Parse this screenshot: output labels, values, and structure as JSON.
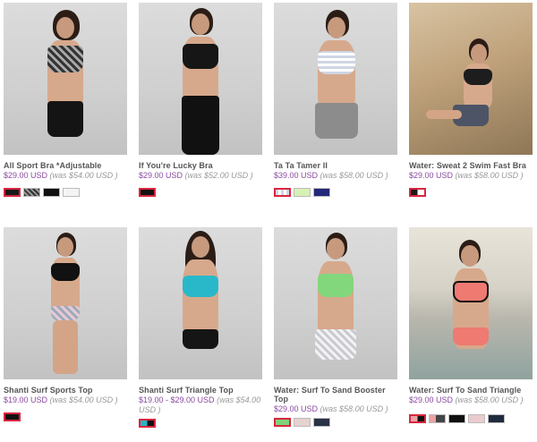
{
  "products": [
    {
      "name": "All Sport Bra *Adjustable",
      "price": "$29.00 USD",
      "was": "(was $54.00 USD )",
      "swatches": [
        "#1a1a1a",
        "#6e6e6e",
        "#111111",
        "#f4f4f4"
      ]
    },
    {
      "name": "If You're Lucky Bra",
      "price": "$29.00 USD",
      "was": "(was $52.00 USD )",
      "swatches": [
        "#111111"
      ]
    },
    {
      "name": "Ta Ta Tamer II",
      "price": "$39.00 USD",
      "was": "(was $58.00 USD )",
      "swatches": [
        "#dfe3ee",
        "#d9f0b5",
        "#23287a"
      ]
    },
    {
      "name": "Water: Sweat 2 Swim Fast Bra",
      "price": "$29.00 USD",
      "was": "(was $58.00 USD )",
      "swatches": [
        "#1a1a1a"
      ]
    },
    {
      "name": "Shanti Surf Sports Top",
      "price": "$19.00 USD",
      "was": "(was $54.00 USD )",
      "swatches": [
        "#111111"
      ]
    },
    {
      "name": "Shanti Surf Triangle Top",
      "price": "$19.00 - $29.00 USD",
      "was": "(was $54.00 USD )",
      "swatches": [
        "#2ab3c4"
      ]
    },
    {
      "name": "Water: Surf To Sand Booster Top",
      "price": "$29.00 USD",
      "was": "(was $58.00 USD )",
      "swatches": [
        "#7fd27a",
        "#e6d2cf",
        "#2a3246"
      ]
    },
    {
      "name": "Water: Surf To Sand Triangle",
      "price": "$29.00 USD",
      "was": "(was $58.00 USD )",
      "swatches": [
        "#e8a3a3",
        "#111111",
        "#eacbcf",
        "#1f2a3d"
      ]
    }
  ]
}
